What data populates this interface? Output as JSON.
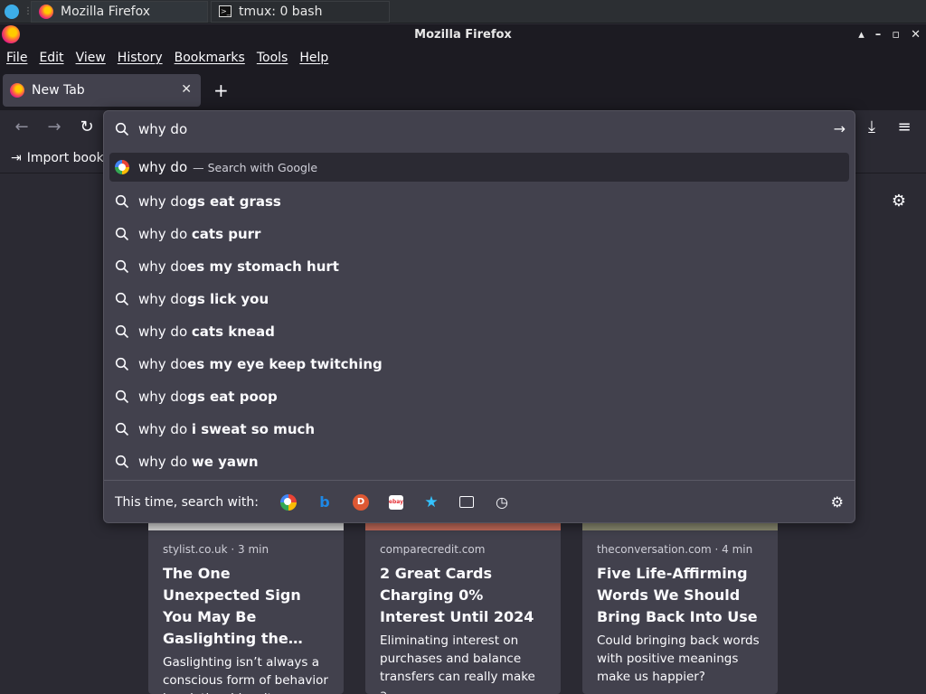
{
  "taskbar": {
    "tasks": [
      {
        "label": "Mozilla Firefox"
      },
      {
        "label": "tmux: 0 bash"
      }
    ]
  },
  "window": {
    "title": "Mozilla Firefox",
    "controls": [
      "▴",
      "–",
      "▫",
      "✕"
    ]
  },
  "menu": [
    "File",
    "Edit",
    "View",
    "History",
    "Bookmarks",
    "Tools",
    "Help"
  ],
  "tabs": [
    {
      "label": "New Tab",
      "close": "✕"
    }
  ],
  "newtab_label": "+",
  "bookmarks": {
    "import_label": "Import book"
  },
  "urlbar": {
    "value": "why do",
    "suggestions": [
      {
        "typed": "why do",
        "rest": "",
        "hint": "— Search with Google",
        "engine": "google"
      },
      {
        "typed": "why do",
        "rest": "gs eat grass"
      },
      {
        "typed": "why do ",
        "rest": "cats purr"
      },
      {
        "typed": "why do",
        "rest": "es my stomach hurt"
      },
      {
        "typed": "why do",
        "rest": "gs lick you"
      },
      {
        "typed": "why do ",
        "rest": "cats knead"
      },
      {
        "typed": "why do",
        "rest": "es my eye keep twitching"
      },
      {
        "typed": "why do",
        "rest": "gs eat poop"
      },
      {
        "typed": "why do ",
        "rest": "i sweat so much"
      },
      {
        "typed": "why do ",
        "rest": "we yawn"
      }
    ],
    "oneoff_label": "This time, search with:"
  },
  "cards": [
    {
      "source": "stylist.co.uk · 3 min",
      "title": "The One Unexpected Sign You May Be Gaslighting the…",
      "desc": "Gaslighting isn’t always a conscious form of behavior in relationships: it may…"
    },
    {
      "source": "comparecredit.com",
      "title": "2 Great Cards Charging 0% Interest Until 2024",
      "desc": "Eliminating interest on purchases and balance transfers can really make a…"
    },
    {
      "source": "theconversation.com · 4 min",
      "title": "Five Life-Affirming Words We Should Bring Back Into Use",
      "desc": "Could bringing back words with positive meanings make us happier?"
    }
  ]
}
